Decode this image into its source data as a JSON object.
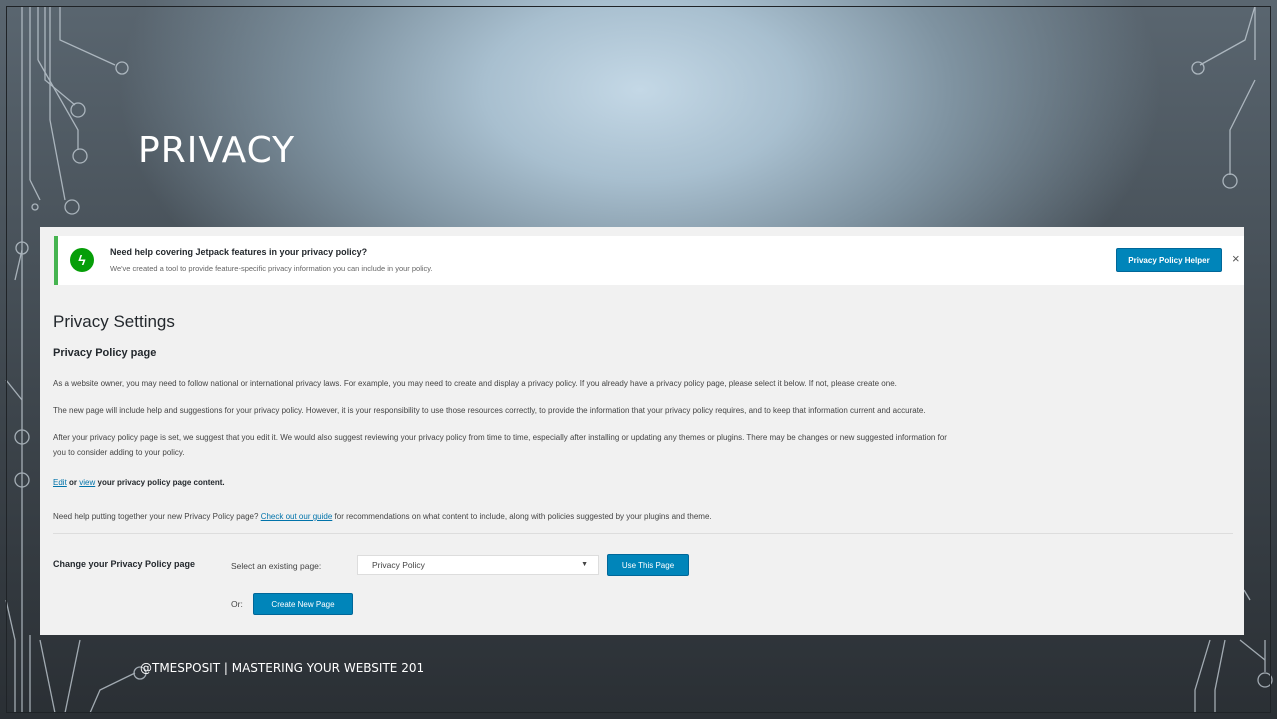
{
  "slide": {
    "title": "PRIVACY",
    "footer": "@TMESPOSIT | MASTERING YOUR WEBSITE 201"
  },
  "notice": {
    "icon": "lightning-bolt-icon",
    "icon_glyph": "ϟ",
    "title": "Need help covering Jetpack features in your privacy policy?",
    "description": "We've created a tool to provide feature-specific privacy information you can include in your policy.",
    "button_label": "Privacy Policy Helper",
    "dismiss_glyph": "×"
  },
  "page": {
    "title": "Privacy Settings",
    "section_title": "Privacy Policy page",
    "paragraph1": "As a website owner, you may need to follow national or international privacy laws. For example, you may need to create and display a privacy policy. If you already have a privacy policy page, please select it below. If not, please create one.",
    "paragraph2": "The new page will include help and suggestions for your privacy policy. However, it is your responsibility to use those resources correctly, to provide the information that your privacy policy requires, and to keep that information current and accurate.",
    "paragraph3a": "After your privacy policy page is set, we suggest that you edit it. We would also suggest reviewing your privacy policy from time to time, especially after installing or updating any themes or plugins. There may be changes or new suggested information for",
    "paragraph3b": "you to consider adding to your policy.",
    "edit_link": "Edit",
    "or_word": " or ",
    "view_link": "view",
    "edit_view_suffix": " your privacy policy page content.",
    "help_prefix": "Need help putting together your new Privacy Policy page? ",
    "help_link": "Check out our guide",
    "help_suffix": " for recommendations on what content to include, along with policies suggested by your plugins and theme.",
    "change_label": "Change your Privacy Policy page",
    "select_label": "Select an existing page:",
    "select_value": "Privacy Policy",
    "use_button": "Use This Page",
    "or_label": "Or:",
    "create_button": "Create New Page"
  },
  "colors": {
    "accent_blue": "#0085ba",
    "notice_green": "#46b450",
    "link_blue": "#0073aa"
  }
}
